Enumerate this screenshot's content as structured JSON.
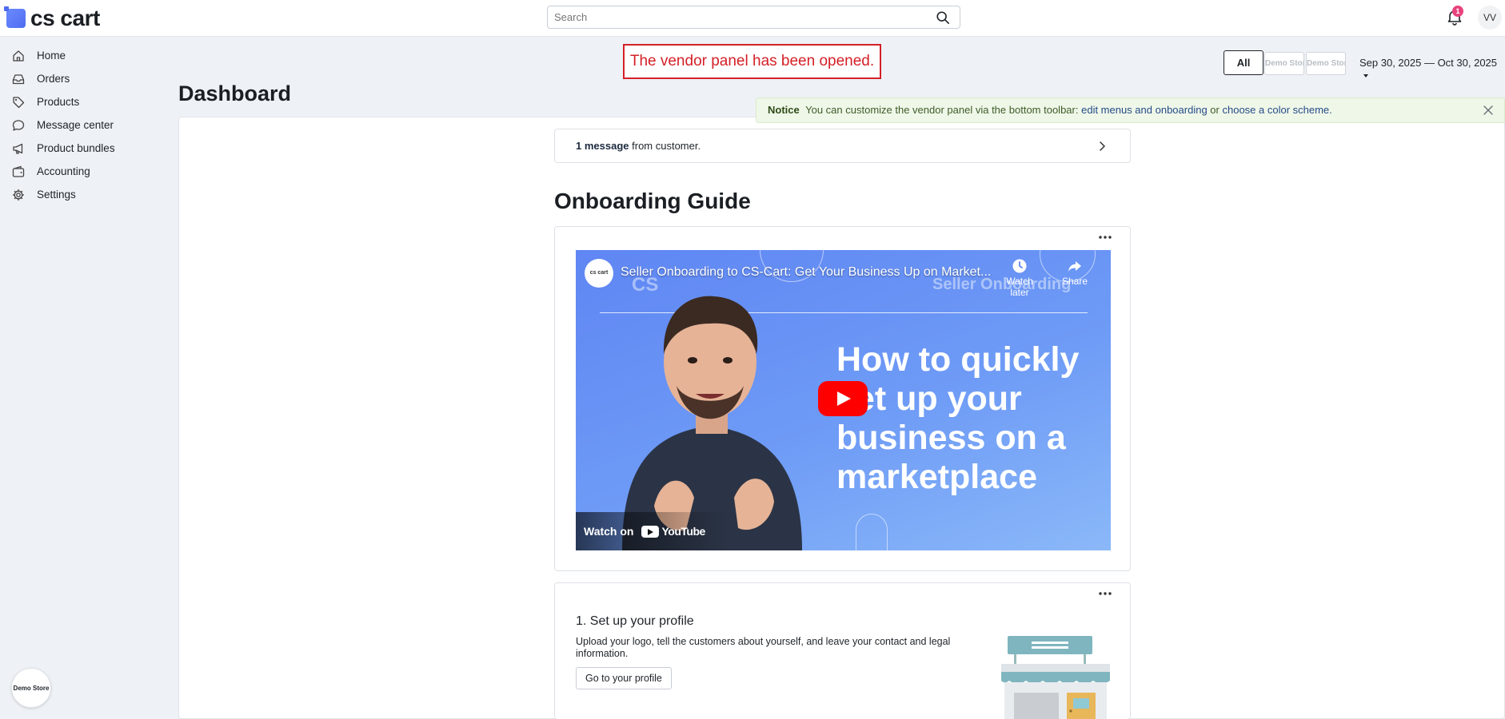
{
  "app": {
    "logo_text": "cs cart",
    "search_placeholder": "Search",
    "notification_count": "1",
    "user_initials": "VV"
  },
  "sidebar": {
    "items": [
      {
        "label": "Home",
        "icon": "home-icon"
      },
      {
        "label": "Orders",
        "icon": "inbox-icon"
      },
      {
        "label": "Products",
        "icon": "tag-icon"
      },
      {
        "label": "Message center",
        "icon": "chat-icon"
      },
      {
        "label": "Product bundles",
        "icon": "megaphone-icon"
      },
      {
        "label": "Accounting",
        "icon": "wallet-icon"
      },
      {
        "label": "Settings",
        "icon": "gear-icon"
      }
    ],
    "store_badge": "Demo Store"
  },
  "toast": "The vendor panel has been opened.",
  "page_title": "Dashboard",
  "filters": {
    "all_label": "All",
    "store_1": "Demo Store",
    "store_2": "Demo Store",
    "date_range": "Sep 30, 2025 — Oct 30, 2025"
  },
  "notice": {
    "label": "Notice",
    "text_1": "You can customize the vendor panel via the bottom toolbar:",
    "link_1": "edit menus and onboarding",
    "text_2": "or",
    "link_2": "choose a color scheme."
  },
  "messages": {
    "count_text": "1 message",
    "rest_text": "from customer."
  },
  "onboarding": {
    "title": "Onboarding Guide",
    "video": {
      "channel": "cs cart",
      "title": "Seller Onboarding to CS-Cart: Get Your Business Up on Market...",
      "ghost_left": "CS",
      "ghost_right": "Seller Onboarding",
      "watch_later": "Watch later",
      "share": "Share",
      "headline_1": "How to quickly",
      "headline_2": "set up your",
      "headline_3": "business on a",
      "headline_4": "marketplace",
      "watch_on": "Watch on",
      "youtube": "YouTube"
    },
    "step1": {
      "title": "1. Set up your profile",
      "description": "Upload your logo, tell the customers about yourself, and leave your contact and legal information.",
      "button": "Go to your profile"
    }
  },
  "colors": {
    "accent_red": "#d42027",
    "notice_bg": "#eff7e9",
    "youtube_red": "#ff0000",
    "badge_pink": "#e8427c"
  }
}
